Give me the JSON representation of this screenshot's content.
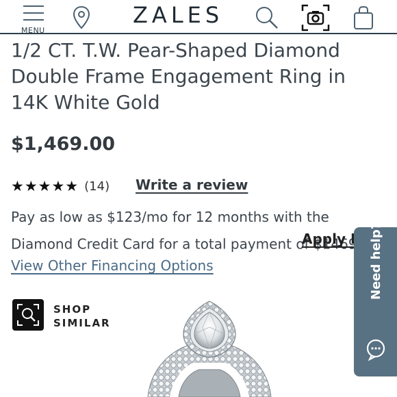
{
  "header": {
    "menu_label": "MENU",
    "logo": "ZALES",
    "icons": [
      "menu-icon",
      "location-pin-icon",
      "search-icon",
      "camera-icon",
      "shopping-bag-icon"
    ]
  },
  "product": {
    "title": "1/2 CT. T.W. Pear-Shaped Diamond Double Frame Engagement Ring in 14K White Gold",
    "price": "$1,469.00",
    "rating": {
      "stars": "★★★★★",
      "count": "(14)",
      "write_review": "Write a review"
    },
    "financing": {
      "text": "Pay as low as $123/mo for 12 months with the Diamond Credit Card for a total payment of $1469.",
      "superscript": "^^",
      "apply_label": "Apply N",
      "other_options": "View Other Financing Options"
    },
    "shop_similar": {
      "line1": "SHOP",
      "line2": "SIMILAR"
    }
  },
  "help": {
    "label": "Need help?"
  },
  "colors": {
    "header_border": "#2c3e4a",
    "link_blue": "#4a6a85",
    "help_tab": "#587183",
    "text": "#3c454d"
  }
}
